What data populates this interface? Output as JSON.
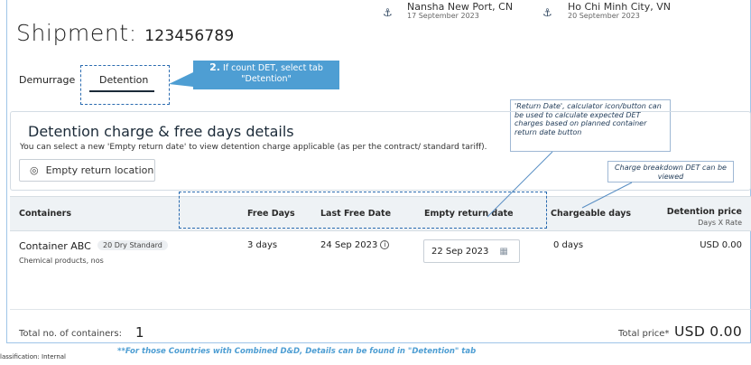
{
  "shipment": {
    "label": "Shipment:",
    "number": "123456789"
  },
  "route": {
    "origin": {
      "name": "Nansha New Port, CN",
      "date": "17 September 2023"
    },
    "destination": {
      "name": "Ho Chi Minh City, VN",
      "date": "20 September 2023"
    }
  },
  "tabs": [
    {
      "label": "Demurrage"
    },
    {
      "label": "Detention",
      "active": true
    }
  ],
  "callouts": {
    "step_number": "2.",
    "step_text_line1": "If count DET, select tab",
    "step_text_line2": "\"Detention\"",
    "return_date_note": "'Return Date', calculator icon/button can be used to calculate expected DET charges based on planned container return date button",
    "breakdown_note": "Charge breakdown DET can be viewed"
  },
  "section": {
    "title": "Detention charge & free days details",
    "subtitle": "You can select a new 'Empty return date' to view detention charge applicable (as per the contract/ standard tariff).",
    "location_button": "Empty return location"
  },
  "table": {
    "headers": {
      "containers": "Containers",
      "free_days": "Free Days",
      "last_free_date": "Last Free Date",
      "empty_return_date": "Empty return date",
      "chargeable_days": "Chargeable days",
      "detention_price": "Detention price",
      "detention_price_sub": "Days X Rate"
    },
    "rows": [
      {
        "container": "Container ABC",
        "container_type": "20 Dry Standard",
        "commodity": "Chemical products, nos",
        "free_days": "3 days",
        "last_free_date": "24 Sep 2023",
        "empty_return_date": "22 Sep 2023",
        "chargeable_days": "0 days",
        "detention_price": "USD 0.00"
      }
    ]
  },
  "totals": {
    "containers_label": "Total no. of containers:",
    "containers_count": "1",
    "price_label": "Total price*",
    "price_value": "USD 0.00"
  },
  "footer": {
    "classification": "lassification: Internal",
    "note": "**For those Countries with Combined D&D, Details can be found in \"Detention\" tab"
  },
  "colors": {
    "callout_blue": "#4e9ed3",
    "dashed_blue": "#2a6bb0",
    "text_dark": "#1b2a38"
  },
  "icons": {
    "anchor": "anchor-icon",
    "pin": "location-pin-icon",
    "calendar": "calendar-icon",
    "info": "info-icon"
  }
}
